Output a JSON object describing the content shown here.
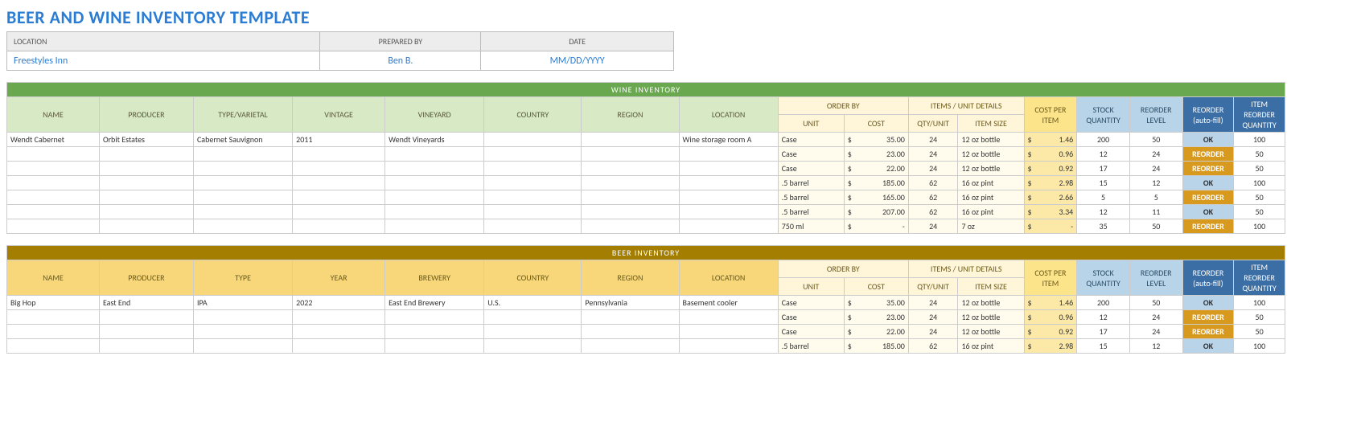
{
  "title": "BEER AND WINE INVENTORY TEMPLATE",
  "info": {
    "headers": {
      "location": "LOCATION",
      "prepared_by": "PREPARED BY",
      "date": "DATE"
    },
    "values": {
      "location": "Freestyles Inn",
      "prepared_by": "Ben B.",
      "date": "MM/DD/YYYY"
    }
  },
  "wine": {
    "banner": "WINE INVENTORY",
    "headers": {
      "name": "NAME",
      "producer": "PRODUCER",
      "type": "TYPE/VARIETAL",
      "vintage": "VINTAGE",
      "vineyard": "VINEYARD",
      "country": "COUNTRY",
      "region": "REGION",
      "location": "LOCATION",
      "order_by": "ORDER BY",
      "unit": "UNIT",
      "cost": "COST",
      "items_details": "ITEMS / UNIT DETAILS",
      "qty_unit": "QTY/UNIT",
      "item_size": "ITEM SIZE",
      "cost_per_item": "COST PER ITEM",
      "stock_qty": "STOCK QUANTITY",
      "reorder_level": "REORDER LEVEL",
      "reorder_auto": "REORDER (auto-fill)",
      "item_reorder_qty": "ITEM REORDER QUANTITY"
    },
    "rows": [
      {
        "name": "Wendt Cabernet",
        "producer": "Orbit Estates",
        "type": "Cabernet Sauvignon",
        "vintage": "2011",
        "vineyard": "Wendt Vineyards",
        "country": "",
        "region": "",
        "location": "Wine storage room A",
        "unit": "Case",
        "cost_sym": "$",
        "cost": "35.00",
        "qty": "24",
        "size": "12 oz bottle",
        "cpi_sym": "$",
        "cpi": "1.46",
        "stock": "200",
        "rlevel": "50",
        "status": "OK",
        "irq": "100"
      },
      {
        "name": "",
        "producer": "",
        "type": "",
        "vintage": "",
        "vineyard": "",
        "country": "",
        "region": "",
        "location": "",
        "unit": "Case",
        "cost_sym": "$",
        "cost": "23.00",
        "qty": "24",
        "size": "12 oz bottle",
        "cpi_sym": "$",
        "cpi": "0.96",
        "stock": "12",
        "rlevel": "24",
        "status": "REORDER",
        "irq": "50"
      },
      {
        "name": "",
        "producer": "",
        "type": "",
        "vintage": "",
        "vineyard": "",
        "country": "",
        "region": "",
        "location": "",
        "unit": "Case",
        "cost_sym": "$",
        "cost": "22.00",
        "qty": "24",
        "size": "12 oz bottle",
        "cpi_sym": "$",
        "cpi": "0.92",
        "stock": "17",
        "rlevel": "24",
        "status": "REORDER",
        "irq": "50"
      },
      {
        "name": "",
        "producer": "",
        "type": "",
        "vintage": "",
        "vineyard": "",
        "country": "",
        "region": "",
        "location": "",
        "unit": ".5 barrel",
        "cost_sym": "$",
        "cost": "185.00",
        "qty": "62",
        "size": "16 oz pint",
        "cpi_sym": "$",
        "cpi": "2.98",
        "stock": "15",
        "rlevel": "12",
        "status": "OK",
        "irq": "100"
      },
      {
        "name": "",
        "producer": "",
        "type": "",
        "vintage": "",
        "vineyard": "",
        "country": "",
        "region": "",
        "location": "",
        "unit": ".5 barrel",
        "cost_sym": "$",
        "cost": "165.00",
        "qty": "62",
        "size": "16 oz pint",
        "cpi_sym": "$",
        "cpi": "2.66",
        "stock": "5",
        "rlevel": "5",
        "status": "REORDER",
        "irq": "50"
      },
      {
        "name": "",
        "producer": "",
        "type": "",
        "vintage": "",
        "vineyard": "",
        "country": "",
        "region": "",
        "location": "",
        "unit": ".5 barrel",
        "cost_sym": "$",
        "cost": "207.00",
        "qty": "62",
        "size": "16 oz pint",
        "cpi_sym": "$",
        "cpi": "3.34",
        "stock": "12",
        "rlevel": "11",
        "status": "OK",
        "irq": "50"
      },
      {
        "name": "",
        "producer": "",
        "type": "",
        "vintage": "",
        "vineyard": "",
        "country": "",
        "region": "",
        "location": "",
        "unit": "750 ml",
        "cost_sym": "$",
        "cost": "-",
        "qty": "24",
        "size": "7 oz",
        "cpi_sym": "$",
        "cpi": "-",
        "stock": "35",
        "rlevel": "50",
        "status": "REORDER",
        "irq": "100"
      }
    ]
  },
  "beer": {
    "banner": "BEER INVENTORY",
    "headers": {
      "name": "NAME",
      "producer": "PRODUCER",
      "type": "TYPE",
      "year": "YEAR",
      "brewery": "BREWERY",
      "country": "COUNTRY",
      "region": "REGION",
      "location": "LOCATION",
      "order_by": "ORDER BY",
      "unit": "UNIT",
      "cost": "COST",
      "items_details": "ITEMS / UNIT DETAILS",
      "qty_unit": "QTY/UNIT",
      "item_size": "ITEM SIZE",
      "cost_per_item": "COST PER ITEM",
      "stock_qty": "STOCK QUANTITY",
      "reorder_level": "REORDER LEVEL",
      "reorder_auto": "REORDER (auto-fill)",
      "item_reorder_qty": "ITEM REORDER QUANTITY"
    },
    "rows": [
      {
        "name": "Big Hop",
        "producer": "East End",
        "type": "IPA",
        "year": "2022",
        "brewery": "East End Brewery",
        "country": "U.S.",
        "region": "Pennsylvania",
        "location": "Basement cooler",
        "unit": "Case",
        "cost_sym": "$",
        "cost": "35.00",
        "qty": "24",
        "size": "12 oz bottle",
        "cpi_sym": "$",
        "cpi": "1.46",
        "stock": "200",
        "rlevel": "50",
        "status": "OK",
        "irq": "100"
      },
      {
        "name": "",
        "producer": "",
        "type": "",
        "year": "",
        "brewery": "",
        "country": "",
        "region": "",
        "location": "",
        "unit": "Case",
        "cost_sym": "$",
        "cost": "23.00",
        "qty": "24",
        "size": "12 oz bottle",
        "cpi_sym": "$",
        "cpi": "0.96",
        "stock": "12",
        "rlevel": "24",
        "status": "REORDER",
        "irq": "50"
      },
      {
        "name": "",
        "producer": "",
        "type": "",
        "year": "",
        "brewery": "",
        "country": "",
        "region": "",
        "location": "",
        "unit": "Case",
        "cost_sym": "$",
        "cost": "22.00",
        "qty": "24",
        "size": "12 oz bottle",
        "cpi_sym": "$",
        "cpi": "0.92",
        "stock": "17",
        "rlevel": "24",
        "status": "REORDER",
        "irq": "50"
      },
      {
        "name": "",
        "producer": "",
        "type": "",
        "year": "",
        "brewery": "",
        "country": "",
        "region": "",
        "location": "",
        "unit": ".5 barrel",
        "cost_sym": "$",
        "cost": "185.00",
        "qty": "62",
        "size": "16 oz pint",
        "cpi_sym": "$",
        "cpi": "2.98",
        "stock": "15",
        "rlevel": "12",
        "status": "OK",
        "irq": "100"
      }
    ]
  }
}
